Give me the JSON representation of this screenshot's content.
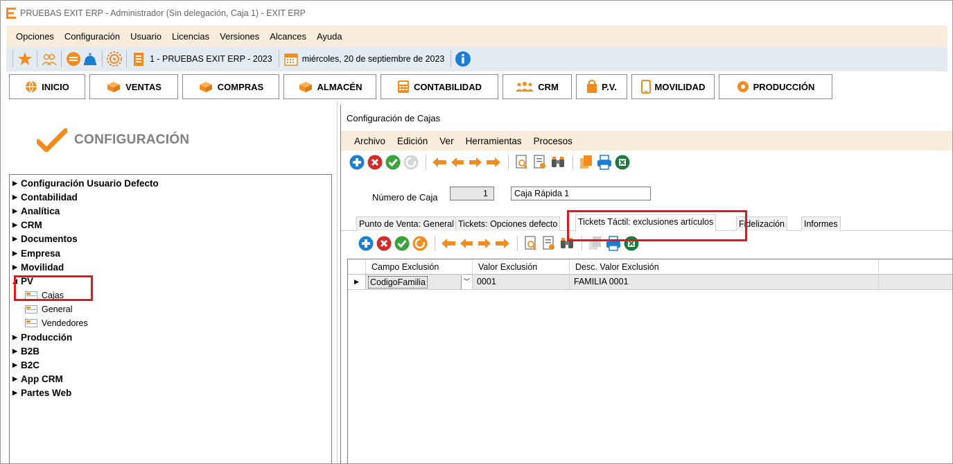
{
  "window": {
    "title": "PRUEBAS EXIT ERP - Administrador (Sin delegación, Caja 1) - EXIT ERP"
  },
  "main_menu": [
    "Opciones",
    "Configuración",
    "Usuario",
    "Licencias",
    "Versiones",
    "Alcances",
    "Ayuda"
  ],
  "toolbar": {
    "company": "1 - PRUEBAS EXIT ERP - 2023",
    "date": "miércoles, 20 de septiembre de 2023"
  },
  "modules": [
    {
      "label": "INICIO",
      "icon": "globe-icon"
    },
    {
      "label": "VENTAS",
      "icon": "box-icon"
    },
    {
      "label": "COMPRAS",
      "icon": "box-icon"
    },
    {
      "label": "ALMACÉN",
      "icon": "box-icon"
    },
    {
      "label": "CONTABILIDAD",
      "icon": "calculator-icon"
    },
    {
      "label": "CRM",
      "icon": "people-icon"
    },
    {
      "label": "P.V.",
      "icon": "bag-icon"
    },
    {
      "label": "MOVILIDAD",
      "icon": "phone-icon"
    },
    {
      "label": "PRODUCCIÓN",
      "icon": "gear-icon"
    }
  ],
  "left_panel": {
    "header": "CONFIGURACIÓN",
    "tree": [
      {
        "label": "Configuración Usuario Defecto",
        "expanded": false
      },
      {
        "label": "Contabilidad",
        "expanded": false
      },
      {
        "label": "Analítica",
        "expanded": false
      },
      {
        "label": "CRM",
        "expanded": false
      },
      {
        "label": "Documentos",
        "expanded": false
      },
      {
        "label": "Empresa",
        "expanded": false
      },
      {
        "label": "Movilidad",
        "expanded": false
      },
      {
        "label": "PV",
        "expanded": true
      },
      {
        "label": "Cajas",
        "child": true
      },
      {
        "label": "General",
        "child": true
      },
      {
        "label": "Vendedores",
        "child": true
      },
      {
        "label": "Producción",
        "expanded": false
      },
      {
        "label": "B2B",
        "expanded": false
      },
      {
        "label": "B2C",
        "expanded": false
      },
      {
        "label": "App CRM",
        "expanded": false
      },
      {
        "label": "Partes Web",
        "expanded": false
      }
    ]
  },
  "child_window": {
    "title": "Configuración de Cajas",
    "menu": [
      "Archivo",
      "Edición",
      "Ver",
      "Herramientas",
      "Procesos"
    ],
    "numero_caja_label": "Número de Caja",
    "numero_caja_value": "1",
    "nombre_caja_value": "Caja Rápida 1",
    "tabs": [
      {
        "label": "Punto de Venta: General",
        "active": false
      },
      {
        "label": "Tickets: Opciones defecto",
        "active": false
      },
      {
        "label": "Tickets Táctil: exclusiones artículos",
        "active": true
      },
      {
        "label": "Fidelización",
        "active": false
      },
      {
        "label": "Informes",
        "active": false
      }
    ],
    "grid": {
      "columns": [
        "Campo Exclusión",
        "Valor Exclusión",
        "Desc. Valor Exclusión"
      ],
      "rows": [
        {
          "campo": "CodigoFamilia",
          "valor": "0001",
          "desc": "FAMILIA 0001"
        }
      ]
    }
  },
  "colors": {
    "brand_orange": "#f28c1e",
    "highlight_red": "#e2161c",
    "menu_bg": "#faecdb",
    "toolbar_bg": "#e5ebf3",
    "add_blue": "#1a7fd4",
    "delete_red": "#d42a2a",
    "ok_green": "#3ba33b",
    "excel_green": "#1d7a3e"
  }
}
